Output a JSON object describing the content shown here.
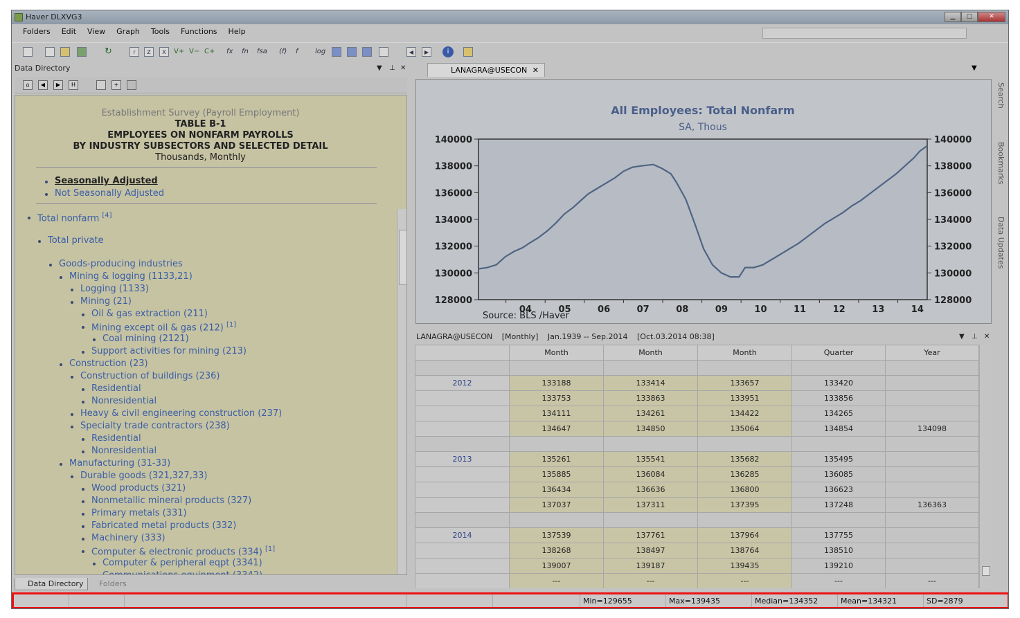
{
  "window": {
    "title": "Haver DLXVG3"
  },
  "menu": [
    "Folders",
    "Edit",
    "View",
    "Graph",
    "Tools",
    "Functions",
    "Help"
  ],
  "toolbar": {
    "labels": [
      "V+",
      "V−",
      "C+",
      "fx",
      "fn",
      "fsa",
      "(f)",
      "f",
      "log"
    ]
  },
  "left_panel": {
    "title": "Data Directory",
    "header_lines": [
      "Establishment Survey (Payroll Employment)",
      "TABLE B-1",
      "EMPLOYEES ON NONFARM PAYROLLS",
      "BY INDUSTRY SUBSECTORS AND SELECTED DETAIL",
      "Thousands, Monthly"
    ],
    "adjust_options": [
      "Seasonally Adjusted",
      "Not Seasonally Adjusted"
    ],
    "tree": [
      {
        "label": "Total nonfarm",
        "note": "[4]"
      },
      {
        "label": "Total private"
      },
      {
        "label": "Goods-producing industries"
      },
      {
        "label": "Mining & logging (1133,21)"
      },
      {
        "label": "Logging (1133)"
      },
      {
        "label": "Mining (21)"
      },
      {
        "label": "Oil & gas extraction (211)"
      },
      {
        "label": "Mining except oil & gas (212)",
        "note": "[1]"
      },
      {
        "label": "Coal mining (2121)"
      },
      {
        "label": "Support activities for mining (213)"
      },
      {
        "label": "Construction (23)"
      },
      {
        "label": "Construction of buildings (236)"
      },
      {
        "label": "Residential"
      },
      {
        "label": "Nonresidential"
      },
      {
        "label": "Heavy & civil engineering construction (237)"
      },
      {
        "label": "Specialty trade contractors (238)"
      },
      {
        "label": "Residential"
      },
      {
        "label": "Nonresidential"
      },
      {
        "label": "Manufacturing (31-33)"
      },
      {
        "label": "Durable goods (321,327,33)"
      },
      {
        "label": "Wood products (321)"
      },
      {
        "label": "Nonmetallic mineral products (327)"
      },
      {
        "label": "Primary metals (331)"
      },
      {
        "label": "Fabricated metal products (332)"
      },
      {
        "label": "Machinery (333)"
      },
      {
        "label": "Computer & electronic products (334)",
        "note": "[1]"
      },
      {
        "label": "Computer & peripheral eqpt (3341)"
      },
      {
        "label": "Communications equipment (3342)"
      }
    ],
    "tabs": [
      "Data Directory",
      "Folders"
    ]
  },
  "chart_tab": {
    "label": "LANAGRA@USECON"
  },
  "chart_data": {
    "type": "line",
    "title": "All Employees: Total Nonfarm",
    "subtitle": "SA, Thous",
    "source": "Source:  BLS /Haver",
    "x_ticks": [
      "04",
      "05",
      "06",
      "07",
      "08",
      "09",
      "10",
      "11",
      "12",
      "13",
      "14"
    ],
    "y_ticks": [
      "128000",
      "130000",
      "132000",
      "134000",
      "136000",
      "138000",
      "140000"
    ],
    "ylim": [
      128000,
      140000
    ],
    "xlim": [
      2003.3,
      2014.75
    ],
    "series": [
      {
        "points": [
          [
            2003.3,
            130300
          ],
          [
            2003.6,
            130400
          ],
          [
            2003.9,
            130600
          ],
          [
            2004.2,
            131200
          ],
          [
            2004.5,
            131600
          ],
          [
            2004.8,
            131900
          ],
          [
            2005.0,
            132200
          ],
          [
            2005.3,
            132600
          ],
          [
            2005.6,
            133100
          ],
          [
            2005.9,
            133700
          ],
          [
            2006.2,
            134400
          ],
          [
            2006.5,
            134900
          ],
          [
            2006.8,
            135500
          ],
          [
            2007.0,
            135900
          ],
          [
            2007.3,
            136300
          ],
          [
            2007.6,
            136700
          ],
          [
            2007.9,
            137100
          ],
          [
            2008.2,
            137600
          ],
          [
            2008.5,
            137900
          ],
          [
            2008.8,
            138000
          ],
          [
            2009.2,
            138100
          ],
          [
            2009.5,
            137800
          ],
          [
            2009.8,
            137400
          ],
          [
            2010.0,
            136700
          ],
          [
            2010.3,
            135500
          ],
          [
            2010.6,
            133700
          ],
          [
            2010.9,
            131800
          ],
          [
            2011.2,
            130600
          ],
          [
            2011.5,
            130000
          ],
          [
            2011.8,
            129700
          ],
          [
            2012.1,
            129700
          ],
          [
            2012.3,
            130400
          ],
          [
            2012.6,
            130400
          ],
          [
            2012.9,
            130600
          ],
          [
            2013.2,
            131000
          ],
          [
            2013.5,
            131400
          ],
          [
            2013.8,
            131800
          ],
          [
            2014.1,
            132200
          ],
          [
            2014.4,
            132700
          ],
          [
            2014.7,
            133200
          ],
          [
            2015.0,
            133700
          ],
          [
            2015.3,
            134100
          ],
          [
            2015.6,
            134500
          ],
          [
            2015.9,
            135000
          ],
          [
            2016.2,
            135400
          ],
          [
            2016.5,
            135900
          ],
          [
            2016.8,
            136400
          ],
          [
            2017.1,
            136900
          ],
          [
            2017.4,
            137400
          ],
          [
            2017.7,
            138000
          ],
          [
            2018.0,
            138600
          ],
          [
            2018.2,
            139100
          ],
          [
            2018.45,
            139500
          ]
        ]
      }
    ]
  },
  "grid_panel": {
    "title_name": "LANAGRA@USECON",
    "frequency": "[Monthly]",
    "range": "Jan.1939 -- Sep.2014",
    "updated": "[Oct.03.2014 08:38]",
    "columns": [
      "",
      "Month",
      "Month",
      "Month",
      "Quarter",
      "Year"
    ],
    "rows": [
      [
        "",
        "",
        "",
        "",
        "",
        ""
      ],
      [
        "2012",
        "133188",
        "133414",
        "133657",
        "133420",
        ""
      ],
      [
        "",
        "133753",
        "133863",
        "133951",
        "133856",
        ""
      ],
      [
        "",
        "134111",
        "134261",
        "134422",
        "134265",
        ""
      ],
      [
        "",
        "134647",
        "134850",
        "135064",
        "134854",
        "134098"
      ],
      [
        "",
        "",
        "",
        "",
        "",
        ""
      ],
      [
        "2013",
        "135261",
        "135541",
        "135682",
        "135495",
        ""
      ],
      [
        "",
        "135885",
        "136084",
        "136285",
        "136085",
        ""
      ],
      [
        "",
        "136434",
        "136636",
        "136800",
        "136623",
        ""
      ],
      [
        "",
        "137037",
        "137311",
        "137395",
        "137248",
        "136363"
      ],
      [
        "",
        "",
        "",
        "",
        "",
        ""
      ],
      [
        "2014",
        "137539",
        "137761",
        "137964",
        "137755",
        ""
      ],
      [
        "",
        "138268",
        "138497",
        "138764",
        "138510",
        ""
      ],
      [
        "",
        "139007",
        "139187",
        "139435",
        "139210",
        ""
      ],
      [
        "",
        "---",
        "---",
        "---",
        "---",
        "---"
      ]
    ]
  },
  "right_sidebar": [
    "Search",
    "Bookmarks",
    "Data Updates"
  ],
  "status": {
    "min": "Min=129655",
    "max": "Max=139435",
    "median": "Median=134352",
    "mean": "Mean=134321",
    "sd": "SD=2879"
  }
}
